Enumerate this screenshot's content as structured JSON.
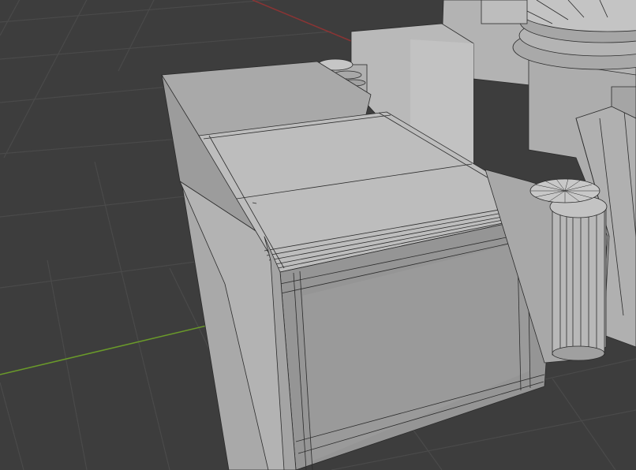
{
  "viewport": {
    "background_color": "#3d3d3d",
    "grid_color": "#484848",
    "x_axis_color": "#8a3434",
    "y_axis_color": "#6a9a2a",
    "mesh_light_color": "#b6b6b6",
    "mesh_mid_color": "#9e9e9e",
    "mesh_dark_color": "#8a8a8a",
    "wire_color": "#2b2b2b"
  }
}
